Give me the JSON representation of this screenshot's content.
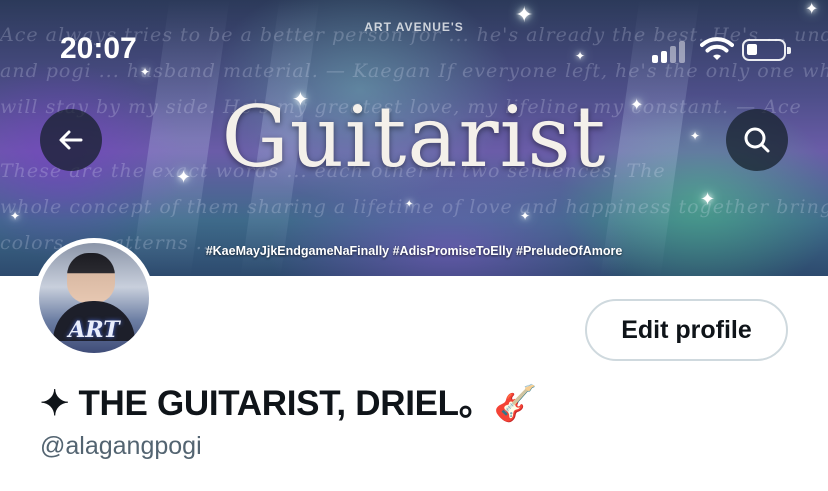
{
  "status_bar": {
    "time": "20:07",
    "signal_bars_active": 2,
    "signal_bars_total": 4,
    "battery_level": 0.25
  },
  "banner": {
    "brand": "ART AVENUE'S",
    "title": "Guitarist",
    "hashtags": "#KaeMayJjkEndgameNaFinally #AdisPromiseToElly #PreludeOfAmore",
    "script_lines": [
      "Ace always tries to be a better person for ... he's already the best. He's ... understanding",
      "and pogi ... husband material. — Kaegan   If everyone left, he's the only one whom I know",
      "will stay by my side. He's my greatest love, my lifeline, my constant. — Ace",
      "These are the exact words ... each other in two sentences. The",
      "whole concept of them sharing a lifetime of love and happiness together brings nothing but the joy and bright",
      "colors ... patterns ... "
    ]
  },
  "nav": {
    "back_icon": "arrow-left-icon",
    "search_icon": "search-icon"
  },
  "profile": {
    "edit_label": "Edit profile",
    "display_name": "✦ THE GUITARIST, DRIEL。🎸",
    "handle": "@alagangpogi",
    "avatar_badge": "ART"
  },
  "colors": {
    "text_primary": "#0f1419",
    "text_secondary": "#536471",
    "button_border": "#cfd9de",
    "nav_button_bg": "#14212b"
  }
}
